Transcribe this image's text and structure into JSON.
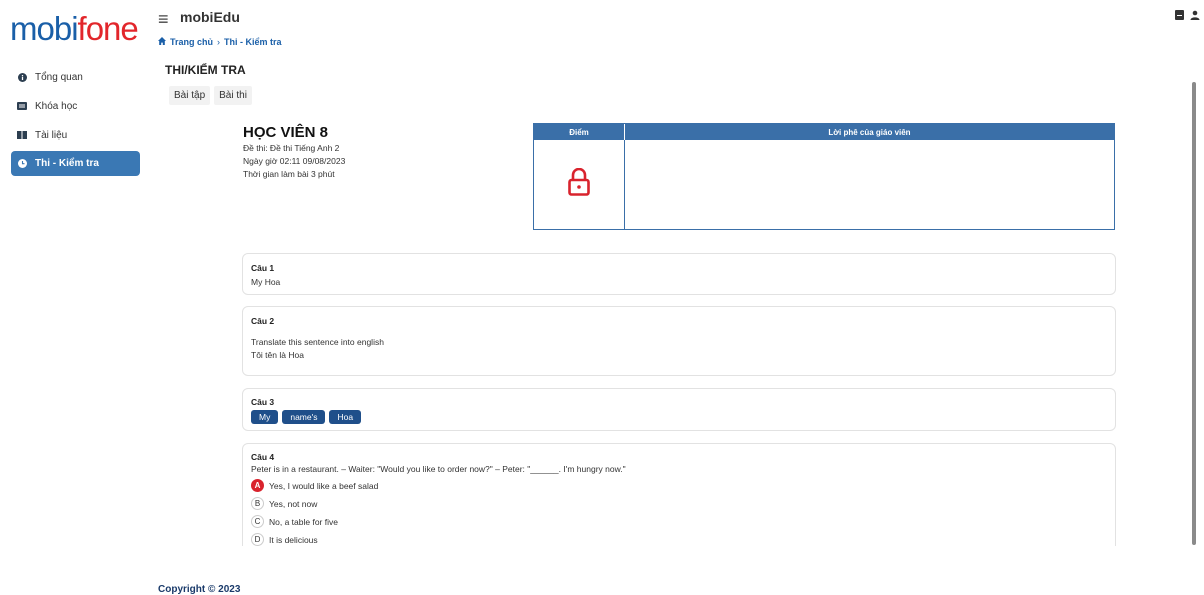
{
  "logo": {
    "main": "mobi",
    "accent": "fone"
  },
  "header": {
    "app_title": "mobiEdu",
    "menu_icon": "hamburger-icon"
  },
  "breadcrumb": {
    "home": "Trang chủ",
    "separator": "›",
    "current": "Thi - Kiểm tra"
  },
  "sidebar": {
    "items": [
      {
        "label": "Tổng quan",
        "icon": "info-icon"
      },
      {
        "label": "Khóa học",
        "icon": "card-icon"
      },
      {
        "label": "Tài liệu",
        "icon": "book-icon"
      },
      {
        "label": "Thi - Kiểm tra",
        "icon": "clock-icon",
        "active": true
      }
    ]
  },
  "page": {
    "title": "THI/KIỂM TRA",
    "tabs": [
      "Bài tập",
      "Bài thi"
    ]
  },
  "exam": {
    "student_name": "HỌC VIÊN 8",
    "exam_name": "Đề thi: Đề thi Tiếng Anh 2",
    "datetime": "Ngày giờ 02:11 09/08/2023",
    "duration": "Thời gian làm bài 3 phút",
    "score_header": "Điểm",
    "comment_header": "Lời phê của giáo viên"
  },
  "questions": [
    {
      "title": "Câu 1",
      "lines": [
        "My Hoa"
      ]
    },
    {
      "title": "Câu 2",
      "lines": [
        "Translate this sentence into english",
        "Tôi tên là Hoa"
      ]
    },
    {
      "title": "Câu 3",
      "chips": [
        "My",
        "name's",
        "Hoa"
      ]
    },
    {
      "title": "Câu 4",
      "lines": [
        "Peter is in a restaurant. – Waiter: \"Would you like to order now?\" – Peter: \"______. I'm hungry now.\""
      ],
      "options": [
        {
          "key": "A",
          "text": "Yes, I would like a beef salad",
          "selected": true
        },
        {
          "key": "B",
          "text": "Yes, not now"
        },
        {
          "key": "C",
          "text": "No, a table for five"
        },
        {
          "key": "D",
          "text": "It is delicious"
        }
      ]
    }
  ],
  "footer": {
    "copyright": "Copyright © 2023"
  },
  "colors": {
    "brand_blue": "#1a5fa8",
    "brand_red": "#e2262b",
    "active_nav": "#3a78b4",
    "table_header": "#3a6fa8",
    "chip": "#1f4f8a",
    "selected_option": "#d9232d"
  }
}
